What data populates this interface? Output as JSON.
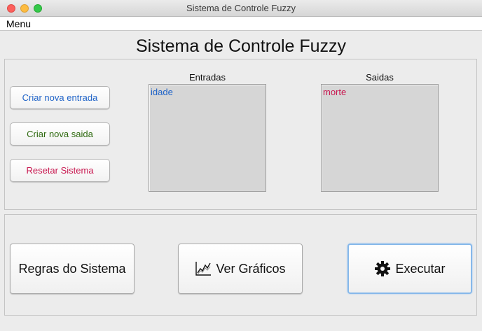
{
  "window": {
    "title": "Sistema de Controle Fuzzy"
  },
  "menubar": {
    "menu_label": "Menu"
  },
  "app": {
    "title": "Sistema de Controle Fuzzy"
  },
  "left_actions": {
    "create_input": "Criar nova entrada",
    "create_output": "Criar nova saida",
    "reset_system": "Resetar Sistema"
  },
  "inputs_list": {
    "label": "Entradas",
    "items": [
      "idade"
    ]
  },
  "outputs_list": {
    "label": "Saidas",
    "items": [
      "morte"
    ]
  },
  "bottom_actions": {
    "rules": "Regras do Sistema",
    "graphs": "Ver Gráficos",
    "execute": "Executar"
  },
  "icons": {
    "graphs": "line-chart-icon",
    "execute": "gear-icon"
  },
  "colors": {
    "input_accent": "#1f63c8",
    "output_accent": "#2f6a10",
    "reset_accent": "#c8174f",
    "focus_ring": "#86b8ea"
  }
}
